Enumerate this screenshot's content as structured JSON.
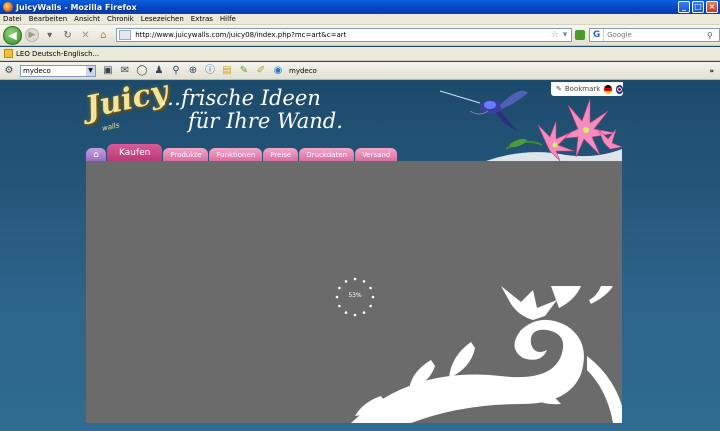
{
  "window": {
    "title": "JuicyWalls - Mozilla Firefox",
    "minimize": "_",
    "maximize": "□",
    "close": "×"
  },
  "menu": [
    "Datei",
    "Bearbeiten",
    "Ansicht",
    "Chronik",
    "Lesezeichen",
    "Extras",
    "Hilfe"
  ],
  "nav": {
    "url": "http://www.juicywalls.com/juicy08/index.php?mc=art&c=art",
    "search_placeholder": "Google",
    "search_engine": "G"
  },
  "bookmarks": [
    {
      "label": "LEO Deutsch-Englisch..."
    }
  ],
  "toolbar": {
    "select_value": "mydeco",
    "extension_label": "mydeco",
    "more": "»"
  },
  "site": {
    "logo": "Juicy",
    "logo_sub": "walls",
    "tagline_line1": "…frische Ideen",
    "tagline_line2": "für Ihre Wand.",
    "bookmark_button": "Bookmark",
    "tabs": [
      {
        "label": "Kaufen",
        "active": true
      },
      {
        "label": "Produkte"
      },
      {
        "label": "Funktionen"
      },
      {
        "label": "Preise"
      },
      {
        "label": "Druckdaten"
      },
      {
        "label": "Versand"
      }
    ],
    "loading_percent": "53%"
  },
  "colors": {
    "titlebar": "#0343c2",
    "tab_pink": "#d9709f",
    "tab_active": "#b83a78",
    "stage": "#6b6b6b",
    "background": "#2d6389"
  }
}
